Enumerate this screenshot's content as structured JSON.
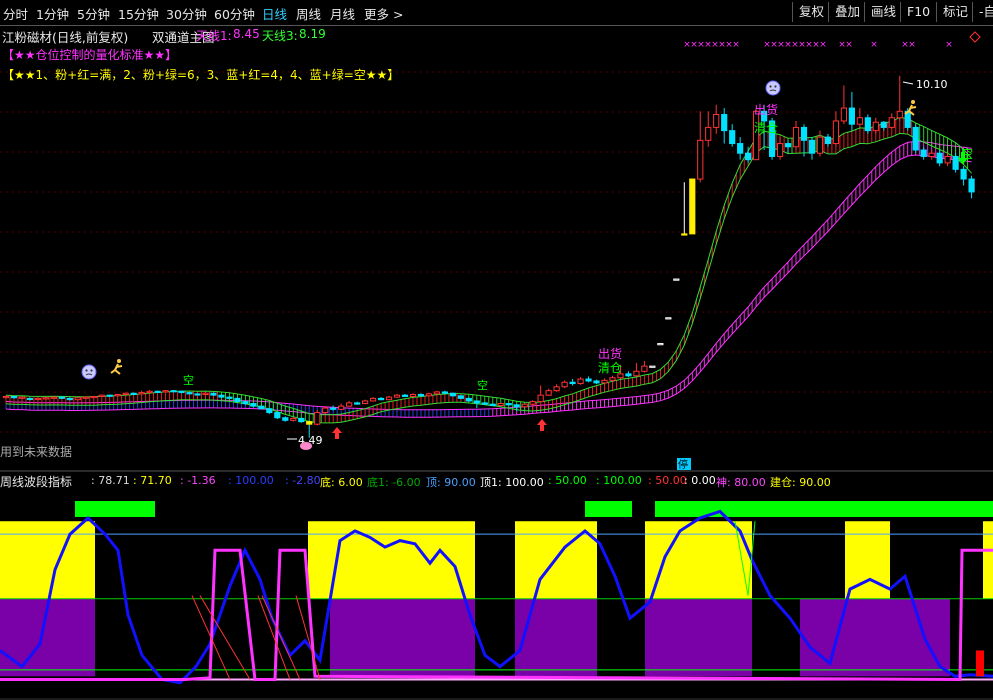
{
  "toolbar": {
    "periods": [
      "分时",
      "1分钟",
      "5分钟",
      "15分钟",
      "30分钟",
      "60分钟",
      "日线",
      "周线",
      "月线",
      "更多 >"
    ],
    "active_period": "日线",
    "right_buttons": [
      "复权",
      "叠加",
      "画线",
      "F10",
      "标记",
      "-自"
    ]
  },
  "header": {
    "stock_name": "江粉磁材(日线,前复权)",
    "chart_title": "双通道主图",
    "tianxian1_label": "天线1:",
    "tianxian1_value": "8.45",
    "tianxian3_label": "天线3:",
    "tianxian3_value": "8.19",
    "line2": "【★★仓位控制的量化标准★★】",
    "line3": "【★★1、粉+红=满，2、粉+绿=6，3、蓝+红=4，4、蓝+绿=空★★】"
  },
  "annotations": {
    "high_price": "10.10",
    "low_price": "4.49",
    "kong": "空",
    "chuhuo": "出货",
    "qingcang": "清仓",
    "future_data": "用到未来数据",
    "ting": "停"
  },
  "indicator": {
    "name": "周线波段指标",
    "values": [
      {
        "text": ": 78.71",
        "color": "#dddddd"
      },
      {
        "text": ": 71.70",
        "color": "#ffff00"
      },
      {
        "text": ": -1.36",
        "color": "#ff44ff"
      },
      {
        "text": ": 100.00",
        "color": "#2b3cff"
      },
      {
        "text": ": -2.80",
        "color": "#4444ff"
      },
      {
        "text": "底: 6.00",
        "color": "#ffff00"
      },
      {
        "text": "底1: -6.00",
        "color": "#00aa00"
      },
      {
        "text": "顶: 90.00",
        "color": "#4aa0ff"
      },
      {
        "text": "顶1: 100.00",
        "color": "#ffffff"
      },
      {
        "text": ": 50.00",
        "color": "#00ff00"
      },
      {
        "text": ": 100.00",
        "color": "#00ff00"
      },
      {
        "text": ": 50.00",
        "color": "#ff3333"
      },
      {
        "text": ": 0.00",
        "color": "#ffffff"
      },
      {
        "text": "神: 80.00",
        "color": "#ff44ff"
      },
      {
        "text": "建仓: 90.00",
        "color": "#ffff00"
      }
    ]
  },
  "colors": {
    "up": "#ff3333",
    "down": "#00e0ff",
    "ribbon_red": "#ff2222",
    "ribbon_green": "#33dd33",
    "ribbon_blue": "#2244ff",
    "ribbon_pink": "#ff33ff",
    "osc_blue": "#1111ff",
    "osc_pink": "#ff33ff",
    "zone_yellow": "#ffff00",
    "zone_purple": "#7a00a8",
    "zone_green": "#00ff00"
  },
  "chart_data": {
    "type": "candlestick",
    "title": "双通道主图",
    "candles": [
      [
        5.12,
        5.13,
        5.1,
        5.14
      ],
      [
        5.13,
        5.11,
        5.1,
        5.14
      ],
      [
        5.11,
        5.12,
        5.09,
        5.13
      ],
      [
        5.1,
        5.09,
        5.07,
        5.11
      ],
      [
        5.09,
        5.1,
        5.08,
        5.11
      ],
      [
        5.1,
        5.11,
        5.09,
        5.12
      ],
      [
        5.11,
        5.12,
        5.1,
        5.13
      ],
      [
        5.12,
        5.1,
        5.09,
        5.13
      ],
      [
        5.1,
        5.08,
        5.07,
        5.11
      ],
      [
        5.08,
        5.11,
        5.07,
        5.12
      ],
      [
        5.11,
        5.12,
        5.1,
        5.13
      ],
      [
        5.12,
        5.13,
        5.11,
        5.14
      ],
      [
        5.13,
        5.15,
        5.12,
        5.16
      ],
      [
        5.15,
        5.14,
        5.13,
        5.16
      ],
      [
        5.14,
        5.16,
        5.13,
        5.17
      ],
      [
        5.16,
        5.18,
        5.15,
        5.19
      ],
      [
        5.18,
        5.17,
        5.16,
        5.19
      ],
      [
        5.17,
        5.19,
        5.16,
        5.22
      ],
      [
        5.19,
        5.21,
        5.18,
        5.23
      ],
      [
        5.21,
        5.2,
        5.19,
        5.22
      ],
      [
        5.2,
        5.22,
        5.19,
        5.23
      ],
      [
        5.22,
        5.21,
        5.2,
        5.23
      ],
      [
        5.21,
        5.19,
        5.18,
        5.22
      ],
      [
        5.19,
        5.17,
        5.16,
        5.2
      ],
      [
        5.17,
        5.16,
        5.15,
        5.18
      ],
      [
        5.16,
        5.18,
        5.15,
        5.19
      ],
      [
        5.18,
        5.15,
        5.14,
        5.19
      ],
      [
        5.15,
        5.12,
        5.11,
        5.16
      ],
      [
        5.12,
        5.1,
        5.09,
        5.13
      ],
      [
        5.1,
        5.05,
        5.04,
        5.11
      ],
      [
        5.05,
        5.02,
        5.0,
        5.06
      ],
      [
        5.02,
        4.98,
        4.96,
        5.03
      ],
      [
        4.98,
        4.94,
        4.93,
        4.99
      ],
      [
        4.94,
        4.88,
        4.86,
        4.95
      ],
      [
        4.88,
        4.8,
        4.78,
        4.89
      ],
      [
        4.8,
        4.76,
        4.74,
        4.82
      ],
      [
        4.76,
        4.79,
        4.74,
        4.81
      ],
      [
        4.79,
        4.74,
        4.72,
        4.8
      ],
      [
        4.74,
        4.7,
        4.49,
        4.76
      ],
      [
        4.7,
        4.88,
        4.68,
        4.92
      ],
      [
        4.88,
        4.95,
        4.86,
        4.98
      ],
      [
        4.95,
        4.93,
        4.91,
        4.99
      ],
      [
        4.93,
        4.98,
        4.92,
        5.02
      ],
      [
        4.98,
        5.03,
        4.97,
        5.06
      ],
      [
        5.03,
        5.02,
        5.0,
        5.05
      ],
      [
        5.02,
        5.06,
        5.01,
        5.08
      ],
      [
        5.06,
        5.1,
        5.05,
        5.12
      ],
      [
        5.1,
        5.08,
        5.07,
        5.12
      ],
      [
        5.08,
        5.12,
        5.07,
        5.14
      ],
      [
        5.12,
        5.15,
        5.11,
        5.17
      ],
      [
        5.15,
        5.13,
        5.12,
        5.17
      ],
      [
        5.13,
        5.16,
        5.12,
        5.18
      ],
      [
        5.16,
        5.14,
        5.13,
        5.18
      ],
      [
        5.14,
        5.17,
        5.13,
        5.19
      ],
      [
        5.17,
        5.2,
        5.16,
        5.22
      ],
      [
        5.2,
        5.18,
        5.17,
        5.22
      ],
      [
        5.18,
        5.14,
        5.13,
        5.19
      ],
      [
        5.14,
        5.1,
        5.09,
        5.15
      ],
      [
        5.1,
        5.06,
        5.05,
        5.11
      ],
      [
        5.06,
        5.03,
        4.95,
        5.07
      ],
      [
        5.03,
        5.01,
        5.0,
        5.04
      ],
      [
        5.01,
        4.99,
        4.98,
        5.02
      ],
      [
        4.99,
        5.02,
        4.98,
        5.03
      ],
      [
        5.02,
        5.0,
        4.99,
        5.03
      ],
      [
        5.0,
        4.97,
        4.9,
        5.01
      ],
      [
        4.97,
        5.01,
        4.96,
        5.02
      ],
      [
        5.01,
        5.05,
        5.0,
        5.07
      ],
      [
        5.05,
        5.15,
        5.04,
        5.3
      ],
      [
        5.15,
        5.22,
        5.14,
        5.25
      ],
      [
        5.22,
        5.28,
        5.2,
        5.32
      ],
      [
        5.28,
        5.35,
        5.26,
        5.38
      ],
      [
        5.35,
        5.33,
        5.3,
        5.4
      ],
      [
        5.33,
        5.4,
        5.31,
        5.43
      ],
      [
        5.4,
        5.37,
        5.35,
        5.44
      ],
      [
        5.37,
        5.34,
        5.32,
        5.39
      ],
      [
        5.34,
        5.38,
        5.33,
        5.41
      ],
      [
        5.38,
        5.42,
        5.36,
        5.45
      ],
      [
        5.42,
        5.48,
        5.4,
        5.62
      ],
      [
        5.48,
        5.45,
        5.43,
        5.52
      ],
      [
        5.45,
        5.52,
        5.44,
        5.65
      ],
      [
        5.52,
        5.6,
        5.5,
        5.68
      ],
      [
        5.6,
        5.6,
        5.6,
        5.6
      ],
      [
        5.95,
        5.95,
        5.95,
        5.95
      ],
      [
        6.35,
        6.35,
        6.35,
        6.35
      ],
      [
        6.95,
        6.95,
        6.95,
        6.95
      ],
      [
        7.65,
        7.65,
        7.65,
        8.45
      ],
      [
        7.65,
        8.5,
        7.65,
        8.5
      ],
      [
        8.5,
        9.1,
        8.45,
        9.55
      ],
      [
        9.1,
        9.3,
        9.0,
        9.55
      ],
      [
        9.3,
        9.5,
        9.2,
        9.65
      ],
      [
        9.5,
        9.25,
        9.05,
        9.6
      ],
      [
        9.25,
        9.05,
        9.0,
        9.35
      ],
      [
        9.05,
        8.9,
        8.8,
        9.15
      ],
      [
        8.9,
        8.8,
        8.75,
        9.0
      ],
      [
        8.8,
        9.55,
        8.8,
        9.6
      ],
      [
        9.55,
        9.4,
        8.95,
        9.65
      ],
      [
        9.4,
        8.85,
        8.8,
        9.45
      ],
      [
        8.85,
        9.05,
        8.8,
        9.15
      ],
      [
        9.05,
        9.0,
        8.9,
        9.1
      ],
      [
        9.0,
        9.3,
        8.95,
        9.4
      ],
      [
        9.3,
        9.1,
        8.85,
        9.35
      ],
      [
        9.1,
        8.9,
        8.8,
        9.15
      ],
      [
        8.9,
        9.15,
        8.85,
        9.25
      ],
      [
        9.15,
        9.05,
        9.0,
        9.2
      ],
      [
        9.05,
        9.4,
        9.0,
        9.55
      ],
      [
        9.4,
        9.6,
        9.35,
        9.95
      ],
      [
        9.6,
        9.35,
        9.25,
        9.85
      ],
      [
        9.35,
        9.45,
        9.3,
        9.6
      ],
      [
        9.45,
        9.25,
        9.2,
        9.5
      ],
      [
        9.25,
        9.38,
        9.2,
        9.45
      ],
      [
        9.38,
        9.3,
        9.25,
        9.4
      ],
      [
        9.3,
        9.45,
        9.28,
        9.52
      ],
      [
        9.45,
        9.55,
        9.4,
        10.1
      ],
      [
        9.55,
        9.3,
        9.25,
        9.6
      ],
      [
        9.3,
        8.95,
        8.9,
        9.35
      ],
      [
        8.95,
        8.85,
        8.8,
        9.0
      ],
      [
        8.85,
        8.9,
        8.8,
        8.95
      ],
      [
        8.9,
        8.75,
        8.7,
        8.95
      ],
      [
        8.75,
        8.85,
        8.7,
        8.9
      ],
      [
        8.85,
        8.65,
        8.6,
        8.9
      ],
      [
        8.65,
        8.5,
        8.4,
        8.7
      ],
      [
        8.5,
        8.3,
        8.2,
        8.55
      ]
    ],
    "ribbon_upper_end": 8.45,
    "ribbon_lower_end": 8.19,
    "low_annotation": 4.49,
    "high_annotation": 10.1
  }
}
